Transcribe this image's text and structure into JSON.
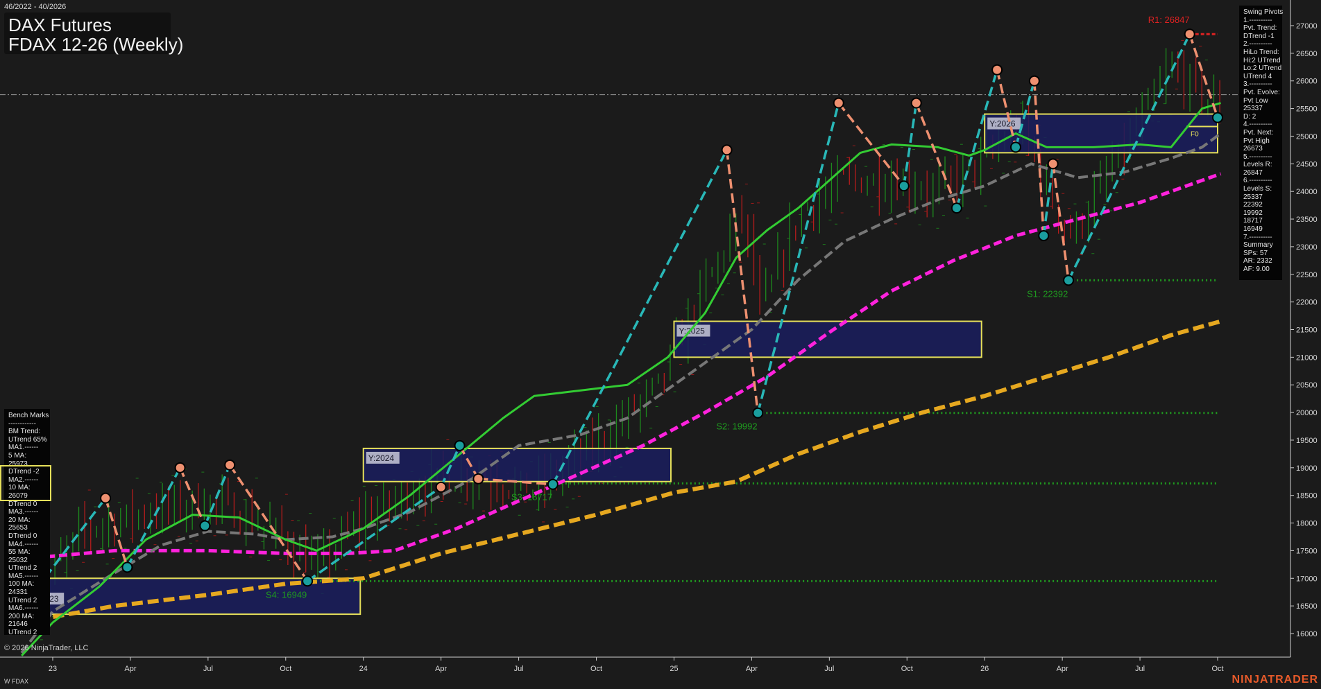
{
  "header": {
    "date_range": "46/2022 - 40/2026",
    "title_line1": "DAX Futures",
    "title_line2": "FDAX 12-26 (Weekly)"
  },
  "benchmarks": {
    "heading": "Bench Marks",
    "lines": [
      "------------",
      "BM Trend:",
      "UTrend 65%",
      "MA1.------",
      "5 MA:",
      "25973",
      "DTrend -2",
      "MA2.------",
      "10 MA:",
      "26079",
      "DTrend 0",
      "MA3.------",
      "20 MA:",
      "25653",
      "DTrend 0",
      "MA4.------",
      "55 MA:",
      "25032",
      "UTrend 2",
      "MA5.------",
      "100 MA:",
      "24331",
      "UTrend 2",
      "MA6.------",
      "200 MA:",
      "21646",
      "UTrend 2"
    ]
  },
  "swing_pivots": {
    "heading": "Swing Pivots",
    "lines": [
      "1.----------",
      "Pvt. Trend:",
      "DTrend -1",
      "2.----------",
      "HiLo Trend:",
      "Hi:2 UTrend",
      "Lo:2 UTrend",
      "UTrend 4",
      "3.----------",
      "Pvt. Evolve:",
      "Pvt Low",
      "25337",
      "D: 2",
      "4.----------",
      "Pvt. Next:",
      "Pvt High",
      "26673",
      "5.----------",
      "Levels R:",
      "26847",
      "6.----------",
      "Levels S:",
      "25337",
      "22392",
      "19992",
      "18717",
      "16949",
      "7.----------",
      "Summary",
      "SPs: 57",
      "AR: 2332",
      "AF: 9.00"
    ]
  },
  "footer": {
    "copyright": "© 2026 NinjaTrader, LLC",
    "symbol": "W FDAX",
    "brand": "NINJATRADER"
  },
  "chart_data": {
    "type": "line",
    "title": "FDAX 12-26 (Weekly)",
    "x_range": [
      "2022-12",
      "2026-10"
    ],
    "x_ticks": [
      {
        "label": "23",
        "x": 2023.0
      },
      {
        "label": "Apr",
        "x": 2023.25
      },
      {
        "label": "Jul",
        "x": 2023.5
      },
      {
        "label": "Oct",
        "x": 2023.75
      },
      {
        "label": "24",
        "x": 2024.0
      },
      {
        "label": "Apr",
        "x": 2024.25
      },
      {
        "label": "Jul",
        "x": 2024.5
      },
      {
        "label": "Oct",
        "x": 2024.75
      },
      {
        "label": "25",
        "x": 2025.0
      },
      {
        "label": "Apr",
        "x": 2025.25
      },
      {
        "label": "Jul",
        "x": 2025.5
      },
      {
        "label": "Oct",
        "x": 2025.75
      },
      {
        "label": "26",
        "x": 2026.0
      },
      {
        "label": "Apr",
        "x": 2026.25
      },
      {
        "label": "Jul",
        "x": 2026.5
      },
      {
        "label": "Oct",
        "x": 2026.75
      }
    ],
    "ylim": [
      15600,
      27400
    ],
    "y_ticks": [
      16000,
      16500,
      17000,
      17500,
      18000,
      18500,
      19000,
      19500,
      20000,
      20500,
      21000,
      21500,
      22000,
      22500,
      23000,
      23500,
      24000,
      24500,
      25000,
      25500,
      26000,
      26500,
      27000
    ],
    "colors": {
      "ma_fast": "#33cc33",
      "ma_mid": "#777777",
      "ma_slow": "#ff22dd",
      "ma_long": "#e6a820",
      "swing_up": "#29b8b8",
      "swing_down": "#ee9070",
      "pivot_high": "#ee9070",
      "pivot_low": "#1a9e9e",
      "up_bar": "#1d8a1d",
      "down_bar": "#b51c1c",
      "resistance": "#dd2222",
      "support": "#1f9a1f",
      "year_box": "#1a1d5e",
      "year_border": "#e6e05a"
    },
    "series": [
      {
        "key": "ma_fast",
        "points": [
          [
            2022.9,
            15600
          ],
          [
            2023.0,
            16200
          ],
          [
            2023.15,
            16850
          ],
          [
            2023.3,
            17700
          ],
          [
            2023.45,
            18150
          ],
          [
            2023.6,
            18100
          ],
          [
            2023.75,
            17700
          ],
          [
            2023.85,
            17500
          ],
          [
            2024.0,
            17900
          ],
          [
            2024.15,
            18500
          ],
          [
            2024.3,
            19200
          ],
          [
            2024.45,
            19900
          ],
          [
            2024.55,
            20300
          ],
          [
            2024.7,
            20400
          ],
          [
            2024.85,
            20500
          ],
          [
            2024.98,
            21000
          ],
          [
            2025.1,
            21800
          ],
          [
            2025.2,
            22800
          ],
          [
            2025.3,
            23300
          ],
          [
            2025.4,
            23700
          ],
          [
            2025.5,
            24200
          ],
          [
            2025.6,
            24700
          ],
          [
            2025.7,
            24850
          ],
          [
            2025.85,
            24800
          ],
          [
            2025.95,
            24650
          ],
          [
            2026.0,
            24750
          ],
          [
            2026.1,
            25050
          ],
          [
            2026.2,
            24800
          ],
          [
            2026.35,
            24800
          ],
          [
            2026.5,
            24850
          ],
          [
            2026.6,
            24800
          ],
          [
            2026.7,
            25500
          ],
          [
            2026.76,
            25600
          ]
        ]
      },
      {
        "key": "ma_mid",
        "points": [
          [
            2022.9,
            15650
          ],
          [
            2023.0,
            16400
          ],
          [
            2023.2,
            17100
          ],
          [
            2023.35,
            17600
          ],
          [
            2023.5,
            17850
          ],
          [
            2023.65,
            17800
          ],
          [
            2023.75,
            17700
          ],
          [
            2023.9,
            17750
          ],
          [
            2024.0,
            17900
          ],
          [
            2024.15,
            18200
          ],
          [
            2024.35,
            18800
          ],
          [
            2024.5,
            19400
          ],
          [
            2024.7,
            19600
          ],
          [
            2024.85,
            19900
          ],
          [
            2025.0,
            20500
          ],
          [
            2025.15,
            21100
          ],
          [
            2025.25,
            21500
          ],
          [
            2025.4,
            22400
          ],
          [
            2025.55,
            23100
          ],
          [
            2025.7,
            23500
          ],
          [
            2025.85,
            23850
          ],
          [
            2026.0,
            24100
          ],
          [
            2026.15,
            24500
          ],
          [
            2026.3,
            24250
          ],
          [
            2026.45,
            24350
          ],
          [
            2026.6,
            24600
          ],
          [
            2026.7,
            24800
          ],
          [
            2026.76,
            25050
          ]
        ]
      },
      {
        "key": "ma_slow",
        "points": [
          [
            2022.9,
            17350
          ],
          [
            2023.2,
            17500
          ],
          [
            2023.5,
            17500
          ],
          [
            2023.75,
            17450
          ],
          [
            2023.95,
            17450
          ],
          [
            2024.1,
            17500
          ],
          [
            2024.3,
            17900
          ],
          [
            2024.5,
            18400
          ],
          [
            2024.7,
            18900
          ],
          [
            2024.9,
            19400
          ],
          [
            2025.1,
            20000
          ],
          [
            2025.3,
            20650
          ],
          [
            2025.5,
            21450
          ],
          [
            2025.7,
            22200
          ],
          [
            2025.9,
            22750
          ],
          [
            2026.1,
            23200
          ],
          [
            2026.3,
            23500
          ],
          [
            2026.5,
            23800
          ],
          [
            2026.65,
            24100
          ],
          [
            2026.76,
            24320
          ]
        ]
      },
      {
        "key": "ma_long",
        "points": [
          [
            2022.9,
            16200
          ],
          [
            2023.2,
            16500
          ],
          [
            2023.5,
            16700
          ],
          [
            2023.75,
            16900
          ],
          [
            2024.0,
            17000
          ],
          [
            2024.25,
            17450
          ],
          [
            2024.5,
            17800
          ],
          [
            2024.75,
            18150
          ],
          [
            2025.0,
            18550
          ],
          [
            2025.2,
            18750
          ],
          [
            2025.4,
            19250
          ],
          [
            2025.6,
            19650
          ],
          [
            2025.8,
            20000
          ],
          [
            2026.0,
            20300
          ],
          [
            2026.2,
            20650
          ],
          [
            2026.4,
            21000
          ],
          [
            2026.6,
            21400
          ],
          [
            2026.76,
            21650
          ]
        ]
      }
    ],
    "swing_legs": [
      [
        [
          2022.92,
          16600
        ],
        [
          2023.17,
          18450
        ]
      ],
      [
        [
          2023.17,
          18450
        ],
        [
          2023.24,
          17200
        ]
      ],
      [
        [
          2023.24,
          17200
        ],
        [
          2023.41,
          19000
        ]
      ],
      [
        [
          2023.41,
          19000
        ],
        [
          2023.49,
          17950
        ]
      ],
      [
        [
          2023.49,
          17950
        ],
        [
          2023.57,
          19050
        ]
      ],
      [
        [
          2023.57,
          19050
        ],
        [
          2023.82,
          16950
        ]
      ],
      [
        [
          2023.82,
          16950
        ],
        [
          2024.25,
          18650
        ]
      ],
      [
        [
          2024.25,
          18650
        ],
        [
          2024.31,
          19400
        ]
      ],
      [
        [
          2024.31,
          19400
        ],
        [
          2024.37,
          18800
        ]
      ],
      [
        [
          2024.37,
          18800
        ],
        [
          2024.61,
          18700
        ]
      ],
      [
        [
          2024.61,
          18700
        ],
        [
          2025.17,
          24750
        ]
      ],
      [
        [
          2025.17,
          24750
        ],
        [
          2025.27,
          19992
        ]
      ],
      [
        [
          2025.27,
          19992
        ],
        [
          2025.53,
          25600
        ]
      ],
      [
        [
          2025.53,
          25600
        ],
        [
          2025.74,
          24100
        ]
      ],
      [
        [
          2025.74,
          24100
        ],
        [
          2025.78,
          25600
        ]
      ],
      [
        [
          2025.78,
          25600
        ],
        [
          2025.91,
          23700
        ]
      ],
      [
        [
          2025.91,
          23700
        ],
        [
          2026.04,
          26200
        ]
      ],
      [
        [
          2026.04,
          26200
        ],
        [
          2026.1,
          24800
        ]
      ],
      [
        [
          2026.1,
          24800
        ],
        [
          2026.16,
          26000
        ]
      ],
      [
        [
          2026.16,
          26000
        ],
        [
          2026.19,
          23200
        ]
      ],
      [
        [
          2026.19,
          23200
        ],
        [
          2026.22,
          24500
        ]
      ],
      [
        [
          2026.22,
          24500
        ],
        [
          2026.27,
          22392
        ]
      ],
      [
        [
          2026.27,
          22392
        ],
        [
          2026.66,
          26847
        ]
      ],
      [
        [
          2026.66,
          26847
        ],
        [
          2026.75,
          25337
        ]
      ]
    ],
    "pivot_highs": [
      [
        2023.17,
        18450
      ],
      [
        2023.41,
        19000
      ],
      [
        2023.57,
        19050
      ],
      [
        2024.25,
        18650
      ],
      [
        2024.37,
        18800
      ],
      [
        2025.17,
        24750
      ],
      [
        2025.53,
        25600
      ],
      [
        2025.78,
        25600
      ],
      [
        2026.04,
        26200
      ],
      [
        2026.16,
        26000
      ],
      [
        2026.22,
        24500
      ],
      [
        2026.66,
        26847
      ]
    ],
    "pivot_lows": [
      [
        2023.24,
        17200
      ],
      [
        2023.49,
        17950
      ],
      [
        2023.82,
        16950
      ],
      [
        2024.31,
        19400
      ],
      [
        2024.61,
        18700
      ],
      [
        2025.27,
        19992
      ],
      [
        2025.74,
        24100
      ],
      [
        2025.91,
        23700
      ],
      [
        2026.1,
        24800
      ],
      [
        2026.19,
        23200
      ],
      [
        2026.27,
        22392
      ],
      [
        2026.75,
        25337
      ]
    ],
    "levels": [
      {
        "label": "R1: 26847",
        "value": 26847,
        "x0": 2026.66,
        "x1": 2026.75,
        "kind": "resistance"
      },
      {
        "label": "S1: 22392",
        "value": 22392,
        "x0": 2026.27,
        "x1": 2026.75,
        "kind": "support"
      },
      {
        "label": "S2: 19992",
        "value": 19992,
        "x0": 2025.27,
        "x1": 2026.75,
        "kind": "support"
      },
      {
        "label": "S3: 18717",
        "value": 18717,
        "x0": 2024.61,
        "x1": 2026.75,
        "kind": "support"
      },
      {
        "label": "S4: 16949",
        "value": 16949,
        "x0": 2023.82,
        "x1": 2026.75,
        "kind": "support"
      }
    ],
    "year_boxes": [
      {
        "label": "Y:2023",
        "x0": 2022.92,
        "x1": 2023.99,
        "y0": 16350,
        "y1": 17000
      },
      {
        "label": "Y:2024",
        "x0": 2024.0,
        "x1": 2024.99,
        "y0": 18750,
        "y1": 19350
      },
      {
        "label": "Y:2025",
        "x0": 2025.0,
        "x1": 2025.99,
        "y0": 21000,
        "y1": 21650
      },
      {
        "label": "Y:2026",
        "x0": 2026.0,
        "x1": 2026.75,
        "y0": 24700,
        "y1": 25400
      }
    ],
    "fib_label": "F0",
    "fib_value": 25050,
    "reference_line": 25750,
    "bar_anchor": [
      [
        2022.92,
        16500
      ],
      [
        2023.1,
        17900
      ],
      [
        2023.3,
        18200
      ],
      [
        2023.5,
        18400
      ],
      [
        2023.7,
        17900
      ],
      [
        2023.85,
        17200
      ],
      [
        2024.0,
        18100
      ],
      [
        2024.2,
        18700
      ],
      [
        2024.35,
        18900
      ],
      [
        2024.55,
        18600
      ],
      [
        2024.75,
        19400
      ],
      [
        2024.95,
        20500
      ],
      [
        2025.1,
        22300
      ],
      [
        2025.22,
        23600
      ],
      [
        2025.28,
        21800
      ],
      [
        2025.4,
        23600
      ],
      [
        2025.55,
        24200
      ],
      [
        2025.7,
        24200
      ],
      [
        2025.85,
        24000
      ],
      [
        2026.0,
        24600
      ],
      [
        2026.12,
        25200
      ],
      [
        2026.2,
        24000
      ],
      [
        2026.28,
        23200
      ],
      [
        2026.45,
        24800
      ],
      [
        2026.6,
        26200
      ],
      [
        2026.76,
        25500
      ]
    ]
  }
}
